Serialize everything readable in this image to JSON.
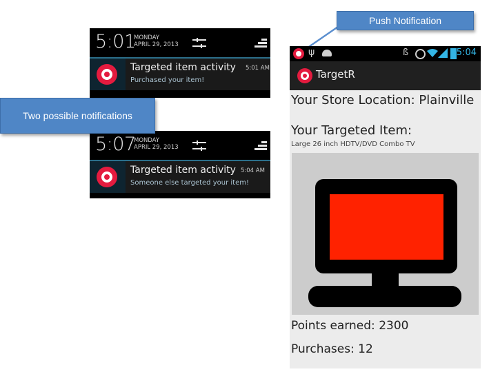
{
  "callouts": {
    "push": "Push Notification",
    "two": "Two possible notifications"
  },
  "notification_1": {
    "time": "5:01",
    "weekday": "MONDAY",
    "date": "APRIL 29, 2013",
    "title": "Targeted item activity",
    "message": "Purchased your item!",
    "timestamp": "5:01 AM"
  },
  "notification_2": {
    "time": "5:07",
    "weekday": "MONDAY",
    "date": "APRIL 29, 2013",
    "title": "Targeted item activity",
    "message": "Someone else targeted your item!",
    "timestamp": "5:04 AM"
  },
  "phone": {
    "status_time": "5:04",
    "app_title": "TargetR",
    "store_location": "Your Store Location: Plainville",
    "targeted_label": "Your Targeted Item:",
    "targeted_item": "Large 26 inch HDTV/DVD Combo TV",
    "points": "Points earned: 2300",
    "purchases": "Purchases: 12"
  },
  "colors": {
    "accent_blue": "#33b5e5",
    "callout_blue": "#4f86c6",
    "app_red": "#e41b3f",
    "tv_screen": "#ff2200"
  }
}
